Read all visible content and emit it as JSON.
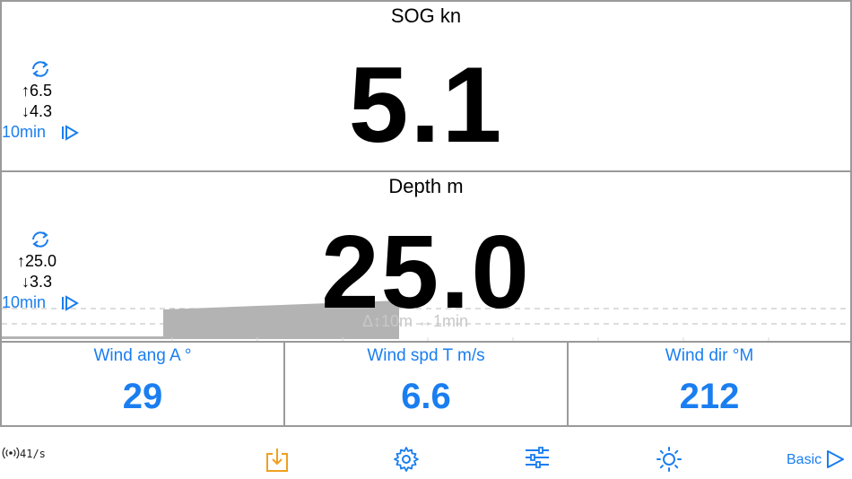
{
  "sog": {
    "title": "SOG kn",
    "value": "5.1",
    "max": "↑6.5",
    "min": "↓4.3",
    "period": "10min"
  },
  "depth": {
    "title": "Depth m",
    "value": "25.0",
    "max": "↑25.0",
    "min": "↓3.3",
    "period": "10min",
    "graph_label": "Δ↕10m ↔1min"
  },
  "tiles": [
    {
      "title": "Wind ang A °",
      "value": "29"
    },
    {
      "title": "Wind spd T m/s",
      "value": "6.6"
    },
    {
      "title": "Wind dir °M",
      "value": "212"
    }
  ],
  "status": {
    "rate": "41/s"
  },
  "toolbar": {
    "mode_label": "Basic"
  },
  "icons": {
    "refresh": "refresh-icon",
    "play": "play-icon",
    "signal": "signal-icon",
    "download": "download-icon",
    "settings": "gear-icon",
    "sliders": "sliders-icon",
    "brightness": "sun-icon",
    "next": "next-icon"
  },
  "colors": {
    "accent": "#1a7ef0",
    "download": "#f0a020",
    "border": "#9a9a9a",
    "graph": "#b3b3b3"
  }
}
